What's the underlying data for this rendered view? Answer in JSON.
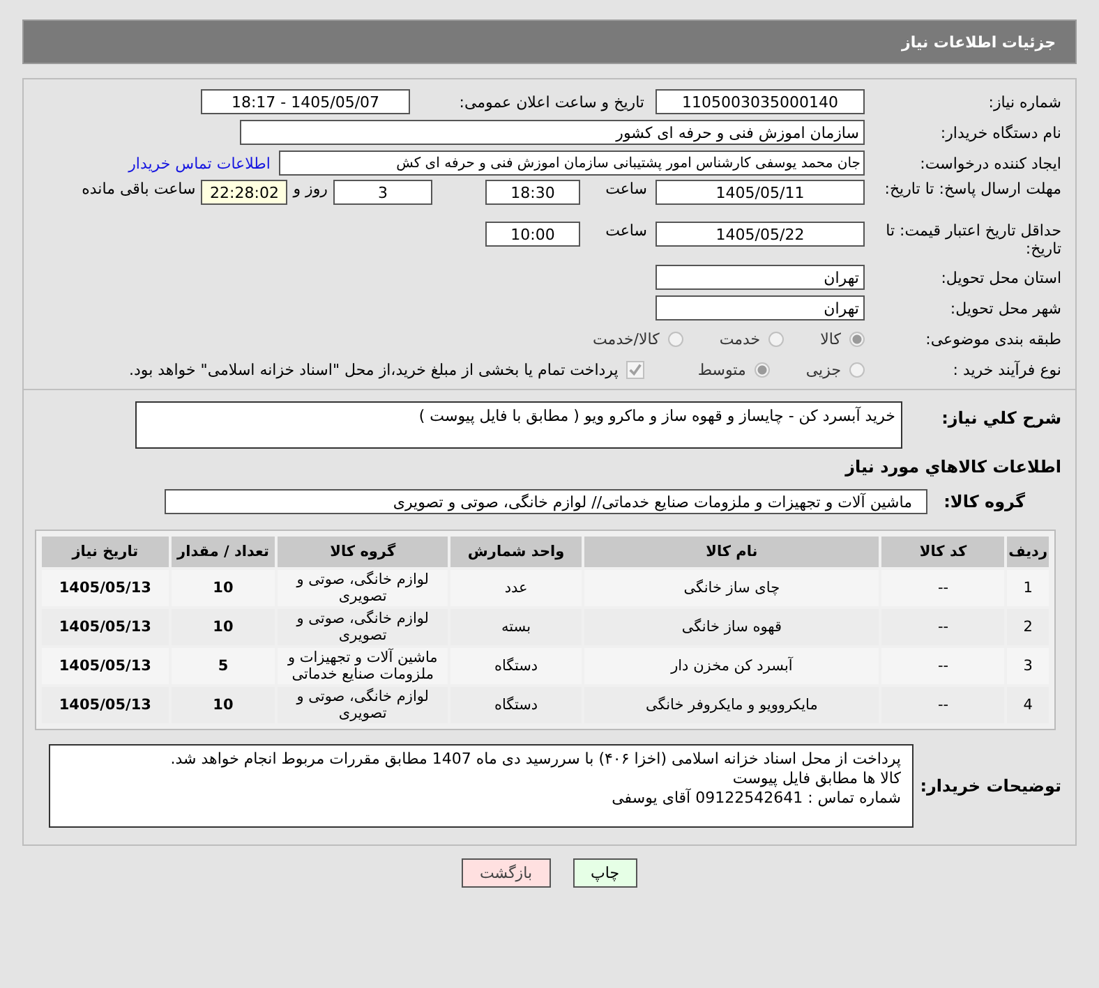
{
  "header": {
    "title": "جزئیات اطلاعات نیاز"
  },
  "need_number": {
    "label": "شماره نیاز:",
    "value": "1105003035000140"
  },
  "announce": {
    "label": "تاریخ و ساعت اعلان عمومی:",
    "value": "1405/05/07 - 18:17"
  },
  "buyer_org": {
    "label": "نام دستگاه خریدار:",
    "value": "سازمان اموزش فنی و حرفه ای کشور"
  },
  "requester": {
    "label": "ایجاد کننده درخواست:",
    "value": "جان محمد یوسفی کارشناس امور پشتیبانی سازمان اموزش فنی و حرفه ای کش",
    "link": "اطلاعات تماس خریدار"
  },
  "reply_deadline": {
    "label": "مهلت ارسال پاسخ: تا تاریخ:",
    "date": "1405/05/11",
    "time_label": "ساعت",
    "time": "18:30",
    "days": "3",
    "days_label": "روز و",
    "remaining": "22:28:02",
    "remaining_label": "ساعت باقی مانده"
  },
  "validity": {
    "label": "حداقل تاریخ اعتبار قیمت: تا تاریخ:",
    "date": "1405/05/22",
    "time_label": "ساعت",
    "time": "10:00"
  },
  "province": {
    "label": "استان محل تحویل:",
    "value": "تهران"
  },
  "city": {
    "label": "شهر محل تحویل:",
    "value": "تهران"
  },
  "category": {
    "label": "طبقه بندی موضوعی:",
    "options": [
      {
        "label": "کالا",
        "selected": true
      },
      {
        "label": "خدمت",
        "selected": false
      },
      {
        "label": "کالا/خدمت",
        "selected": false
      }
    ]
  },
  "process": {
    "label": "نوع فرآیند خرید :",
    "options": [
      {
        "label": "جزیی",
        "selected": false
      },
      {
        "label": "متوسط",
        "selected": true
      }
    ],
    "payment": {
      "checked": true,
      "label": "پرداخت تمام یا بخشی از مبلغ خرید،از محل \"اسناد خزانه اسلامی\" خواهد بود."
    }
  },
  "description": {
    "label": "شرح کلي نياز:",
    "value": "خرید آبسرد کن - چایساز و قهوه ساز و ماکرو ویو ( مطابق با فایل پیوست )"
  },
  "goods_title": "اطلاعات کالاهاي مورد نياز",
  "goods_group": {
    "label": "گروه کالا:",
    "value": "ماشین آلات و تجهیزات و ملزومات صنایع خدماتی// لوازم خانگی، صوتی و تصویری"
  },
  "table": {
    "columns": [
      "ردیف",
      "کد کالا",
      "نام کالا",
      "واحد شمارش",
      "گروه کالا",
      "تعداد / مقدار",
      "تاریخ نیاز"
    ],
    "rows": [
      [
        "1",
        "--",
        "چای ساز خانگی",
        "عدد",
        "لوازم خانگی، صوتی و تصویری",
        "10",
        "1405/05/13"
      ],
      [
        "2",
        "--",
        "قهوه ساز خانگی",
        "بسته",
        "لوازم خانگی، صوتی و تصویری",
        "10",
        "1405/05/13"
      ],
      [
        "3",
        "--",
        "آبسرد کن مخزن دار",
        "دستگاه",
        "ماشین آلات و تجهیزات و ملزومات صنایع خدماتی",
        "5",
        "1405/05/13"
      ],
      [
        "4",
        "--",
        "مایکروویو و مایکروفر خانگی",
        "دستگاه",
        "لوازم خانگی، صوتی و تصویری",
        "10",
        "1405/05/13"
      ]
    ]
  },
  "buyer_notes": {
    "label": "توضیحات خریدار:",
    "lines": [
      "پرداخت از محل اسناد خزانه اسلامی (اخزا ۴۰۶) با سررسید دی ماه 1407 مطابق مقررات مربوط انجام خواهد شد.",
      "کالا ها مطابق فایل پیوست",
      "شماره تماس : 09122542641 آقای یوسفی"
    ]
  },
  "buttons": [
    {
      "label": "چاپ",
      "kind": "print"
    },
    {
      "label": "بازگشت",
      "kind": "back"
    }
  ]
}
